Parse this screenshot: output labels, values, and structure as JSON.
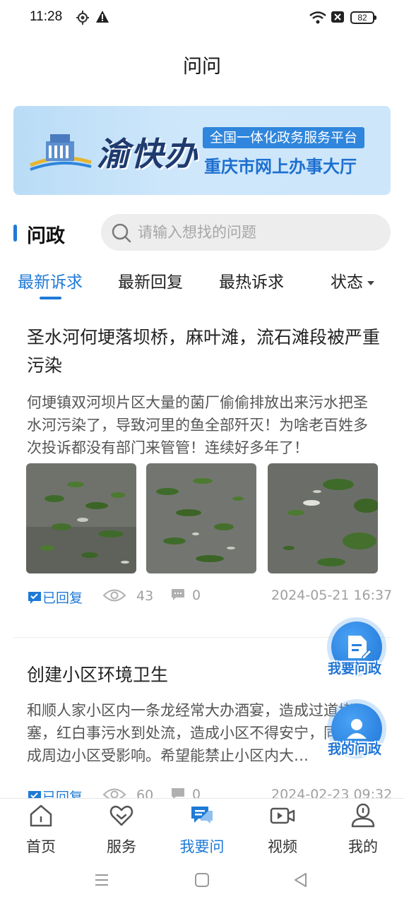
{
  "status_bar": {
    "time": "11:28",
    "battery": "82"
  },
  "header": {
    "title": "问问"
  },
  "banner": {
    "brand": "渝快办",
    "tagline": "全国一体化政务服务平台",
    "subtitle": "重庆市网上办事大厅"
  },
  "section": {
    "title": "问政",
    "search_placeholder": "请输入想找的问题"
  },
  "tabs": [
    {
      "label": "最新诉求",
      "active": true
    },
    {
      "label": "最新回复",
      "active": false
    },
    {
      "label": "最热诉求",
      "active": false
    },
    {
      "label": "状态",
      "active": false
    }
  ],
  "posts": [
    {
      "title": "圣水河何埂落坝桥，麻叶滩，流石滩段被严重污染",
      "body": "何埂镇双河坝片区大量的菌厂偷偷排放出来污水把圣水河污染了，导致河里的鱼全部歼灭！为啥老百姓多次投诉都没有部门来管管！连续好多年了！",
      "status": "已回复",
      "views": "43",
      "comments": "0",
      "date": "2024-05-21 16:37"
    },
    {
      "title": "创建小区环境卫生",
      "body": "和顺人家小区内一条龙经常大办酒宴，造成过道堵塞，红白事污水到处流，造成小区不得安宁，同时造成周边小区受影响。希望能禁止小区内大…",
      "status": "已回复",
      "views": "60",
      "comments": "0",
      "date": "2024-02-23 09:32"
    }
  ],
  "fabs": {
    "ask": "我要问政",
    "mine": "我的问政"
  },
  "bottom_nav": [
    {
      "label": "首页",
      "icon": "home-icon"
    },
    {
      "label": "服务",
      "icon": "heart-icon"
    },
    {
      "label": "我要问",
      "icon": "chat-icon"
    },
    {
      "label": "视频",
      "icon": "video-icon"
    },
    {
      "label": "我的",
      "icon": "user-icon"
    }
  ],
  "colors": {
    "accent": "#1f7ad6",
    "text": "#222222",
    "muted": "#a0a0a0"
  }
}
